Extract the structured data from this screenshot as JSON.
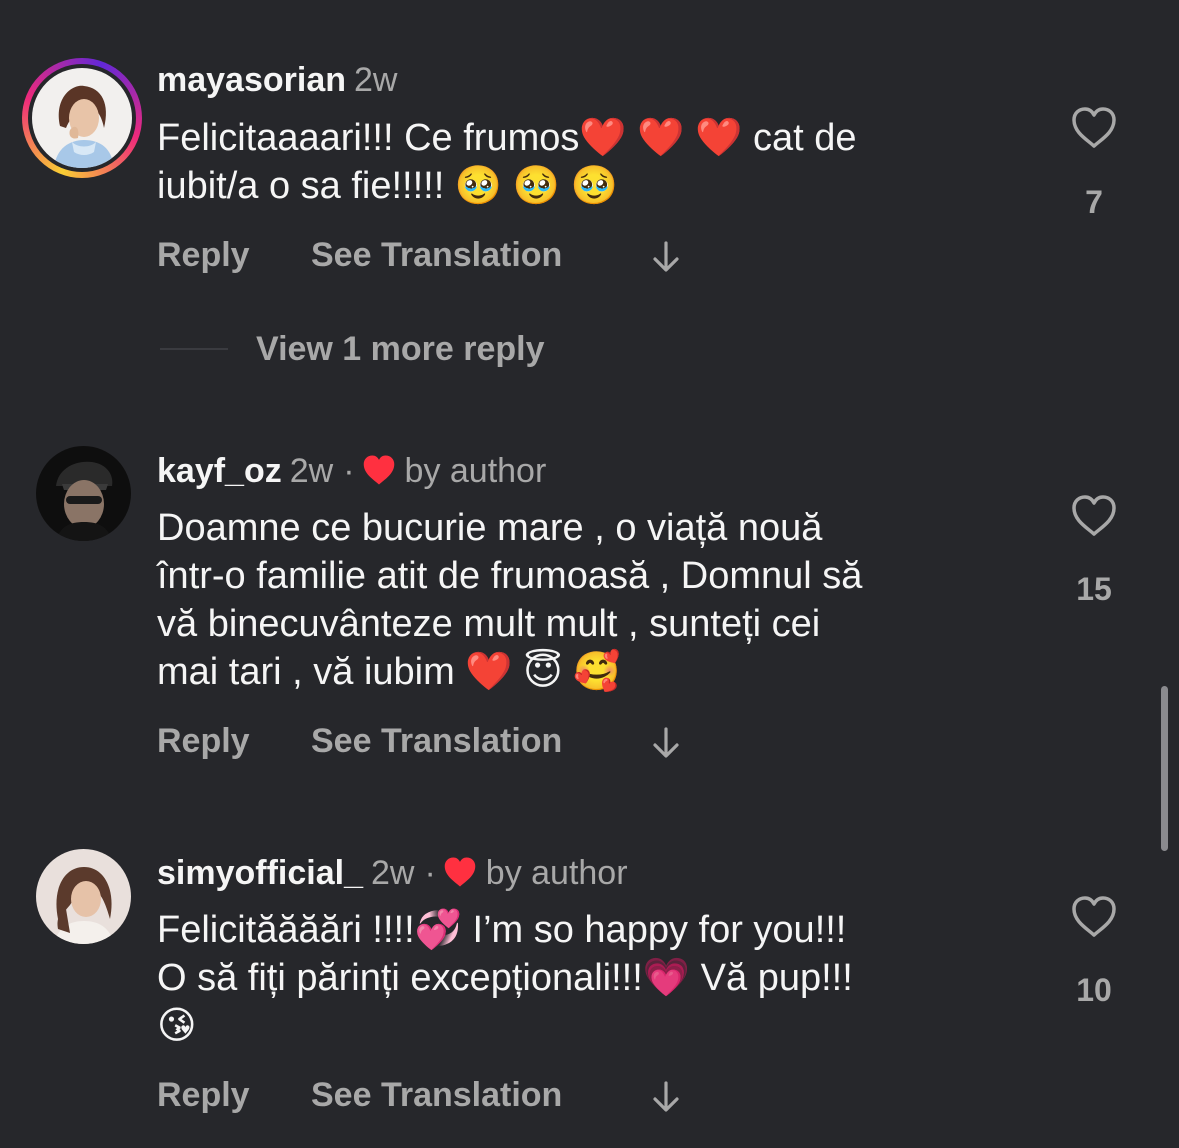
{
  "comments": [
    {
      "username": "mayasorian",
      "age": "2w",
      "text": "Felicitaaaari!!! Ce frumos❤️ ❤️ ❤️  cat de\niubit/a o sa fie!!!!! 🥹 🥹 🥹",
      "likes": "7",
      "liked_by_author": false,
      "story_ring": true
    },
    {
      "username": "kayf_oz",
      "age": "2w",
      "dot": "·",
      "by_author": "by author",
      "text": "Doamne ce bucurie mare , o viață nouă\nîntr-o familie atit de frumoasă , Domnul să\nvă binecuvânteze mult mult , sunteți cei\nmai tari , vă iubim ❤️ 😇 🥰",
      "likes": "15",
      "liked_by_author": true
    },
    {
      "username": "simyofficial_",
      "age": "2w",
      "dot": "·",
      "by_author": "by author",
      "text": "Felicităăăări !!!!💞  I’m so happy for you!!!\nO să fiți părinți excepționali!!!💗  Vă pup!!!\n😘",
      "likes": "10",
      "liked_by_author": true
    }
  ],
  "actions": {
    "reply": "Reply",
    "see_translation": "See Translation"
  },
  "view_more_replies": "View 1 more reply",
  "colors": {
    "background": "#26272b",
    "primary_text": "#f5f5f5",
    "secondary_text": "#a8a8a8",
    "author_heart": "#ff3040"
  },
  "icons": [
    "heart-outline-icon",
    "heart-filled-icon",
    "arrow-down-icon"
  ]
}
